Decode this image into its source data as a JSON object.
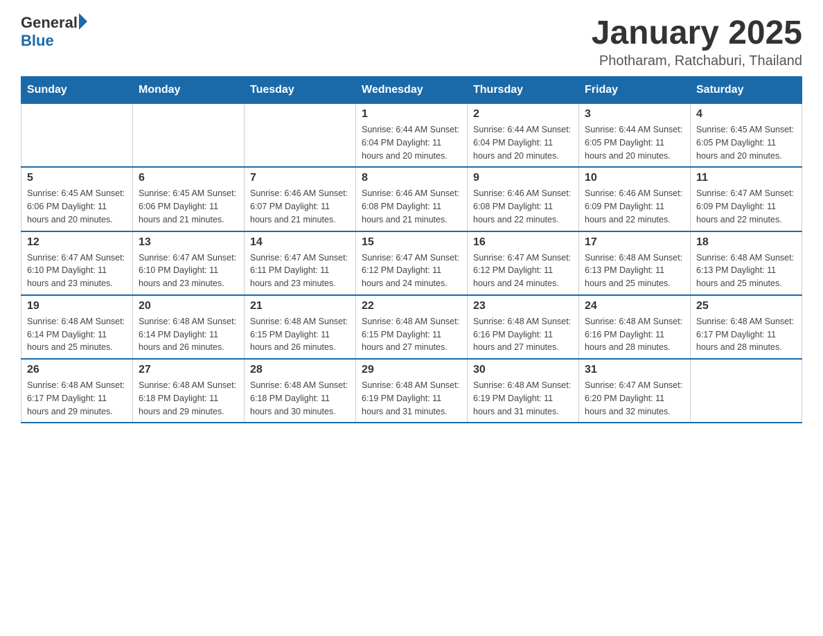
{
  "header": {
    "logo_general": "General",
    "logo_blue": "Blue",
    "title": "January 2025",
    "location": "Photharam, Ratchaburi, Thailand"
  },
  "days_of_week": [
    "Sunday",
    "Monday",
    "Tuesday",
    "Wednesday",
    "Thursday",
    "Friday",
    "Saturday"
  ],
  "weeks": [
    [
      {
        "day": "",
        "info": ""
      },
      {
        "day": "",
        "info": ""
      },
      {
        "day": "",
        "info": ""
      },
      {
        "day": "1",
        "info": "Sunrise: 6:44 AM\nSunset: 6:04 PM\nDaylight: 11 hours and 20 minutes."
      },
      {
        "day": "2",
        "info": "Sunrise: 6:44 AM\nSunset: 6:04 PM\nDaylight: 11 hours and 20 minutes."
      },
      {
        "day": "3",
        "info": "Sunrise: 6:44 AM\nSunset: 6:05 PM\nDaylight: 11 hours and 20 minutes."
      },
      {
        "day": "4",
        "info": "Sunrise: 6:45 AM\nSunset: 6:05 PM\nDaylight: 11 hours and 20 minutes."
      }
    ],
    [
      {
        "day": "5",
        "info": "Sunrise: 6:45 AM\nSunset: 6:06 PM\nDaylight: 11 hours and 20 minutes."
      },
      {
        "day": "6",
        "info": "Sunrise: 6:45 AM\nSunset: 6:06 PM\nDaylight: 11 hours and 21 minutes."
      },
      {
        "day": "7",
        "info": "Sunrise: 6:46 AM\nSunset: 6:07 PM\nDaylight: 11 hours and 21 minutes."
      },
      {
        "day": "8",
        "info": "Sunrise: 6:46 AM\nSunset: 6:08 PM\nDaylight: 11 hours and 21 minutes."
      },
      {
        "day": "9",
        "info": "Sunrise: 6:46 AM\nSunset: 6:08 PM\nDaylight: 11 hours and 22 minutes."
      },
      {
        "day": "10",
        "info": "Sunrise: 6:46 AM\nSunset: 6:09 PM\nDaylight: 11 hours and 22 minutes."
      },
      {
        "day": "11",
        "info": "Sunrise: 6:47 AM\nSunset: 6:09 PM\nDaylight: 11 hours and 22 minutes."
      }
    ],
    [
      {
        "day": "12",
        "info": "Sunrise: 6:47 AM\nSunset: 6:10 PM\nDaylight: 11 hours and 23 minutes."
      },
      {
        "day": "13",
        "info": "Sunrise: 6:47 AM\nSunset: 6:10 PM\nDaylight: 11 hours and 23 minutes."
      },
      {
        "day": "14",
        "info": "Sunrise: 6:47 AM\nSunset: 6:11 PM\nDaylight: 11 hours and 23 minutes."
      },
      {
        "day": "15",
        "info": "Sunrise: 6:47 AM\nSunset: 6:12 PM\nDaylight: 11 hours and 24 minutes."
      },
      {
        "day": "16",
        "info": "Sunrise: 6:47 AM\nSunset: 6:12 PM\nDaylight: 11 hours and 24 minutes."
      },
      {
        "day": "17",
        "info": "Sunrise: 6:48 AM\nSunset: 6:13 PM\nDaylight: 11 hours and 25 minutes."
      },
      {
        "day": "18",
        "info": "Sunrise: 6:48 AM\nSunset: 6:13 PM\nDaylight: 11 hours and 25 minutes."
      }
    ],
    [
      {
        "day": "19",
        "info": "Sunrise: 6:48 AM\nSunset: 6:14 PM\nDaylight: 11 hours and 25 minutes."
      },
      {
        "day": "20",
        "info": "Sunrise: 6:48 AM\nSunset: 6:14 PM\nDaylight: 11 hours and 26 minutes."
      },
      {
        "day": "21",
        "info": "Sunrise: 6:48 AM\nSunset: 6:15 PM\nDaylight: 11 hours and 26 minutes."
      },
      {
        "day": "22",
        "info": "Sunrise: 6:48 AM\nSunset: 6:15 PM\nDaylight: 11 hours and 27 minutes."
      },
      {
        "day": "23",
        "info": "Sunrise: 6:48 AM\nSunset: 6:16 PM\nDaylight: 11 hours and 27 minutes."
      },
      {
        "day": "24",
        "info": "Sunrise: 6:48 AM\nSunset: 6:16 PM\nDaylight: 11 hours and 28 minutes."
      },
      {
        "day": "25",
        "info": "Sunrise: 6:48 AM\nSunset: 6:17 PM\nDaylight: 11 hours and 28 minutes."
      }
    ],
    [
      {
        "day": "26",
        "info": "Sunrise: 6:48 AM\nSunset: 6:17 PM\nDaylight: 11 hours and 29 minutes."
      },
      {
        "day": "27",
        "info": "Sunrise: 6:48 AM\nSunset: 6:18 PM\nDaylight: 11 hours and 29 minutes."
      },
      {
        "day": "28",
        "info": "Sunrise: 6:48 AM\nSunset: 6:18 PM\nDaylight: 11 hours and 30 minutes."
      },
      {
        "day": "29",
        "info": "Sunrise: 6:48 AM\nSunset: 6:19 PM\nDaylight: 11 hours and 31 minutes."
      },
      {
        "day": "30",
        "info": "Sunrise: 6:48 AM\nSunset: 6:19 PM\nDaylight: 11 hours and 31 minutes."
      },
      {
        "day": "31",
        "info": "Sunrise: 6:47 AM\nSunset: 6:20 PM\nDaylight: 11 hours and 32 minutes."
      },
      {
        "day": "",
        "info": ""
      }
    ]
  ]
}
